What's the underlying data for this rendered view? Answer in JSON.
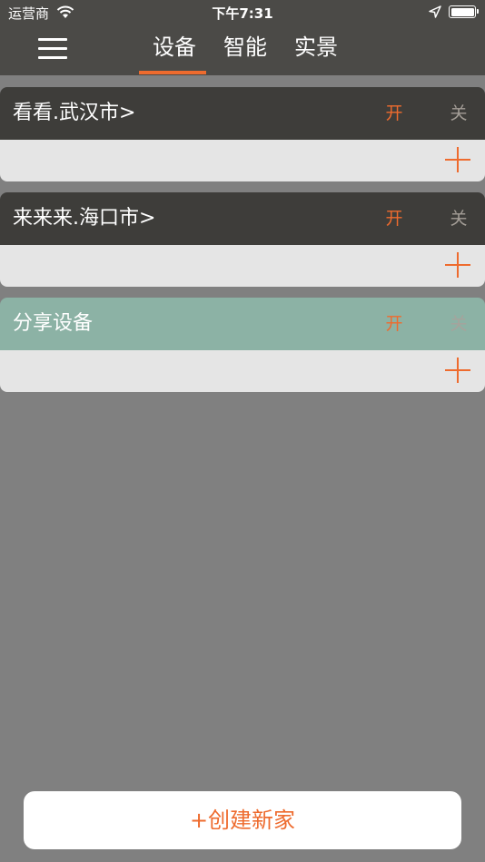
{
  "status_bar": {
    "carrier": "运营商",
    "time": "下午7:31",
    "icons": [
      "wifi-icon",
      "location-arrow-icon",
      "battery-icon"
    ]
  },
  "nav": {
    "menu_icon": "hamburger-menu-icon",
    "tabs": [
      {
        "label": "设备",
        "active": true
      },
      {
        "label": "智能",
        "active": false
      },
      {
        "label": "实景",
        "active": false
      }
    ]
  },
  "homes": [
    {
      "title": "看看.武汉市>",
      "on_label": "开",
      "off_label": "关",
      "add_icon": "plus-icon"
    },
    {
      "title": "来来来.海口市>",
      "on_label": "开",
      "off_label": "关",
      "add_icon": "plus-icon"
    },
    {
      "title": "分享设备",
      "on_label": "开",
      "off_label": "关",
      "add_icon": "plus-icon"
    }
  ],
  "create_button": {
    "label": "+创建新家"
  },
  "colors": {
    "accent": "#ee6b2e",
    "nav_background": "#4b4a47",
    "card_header": "#3e3d3a",
    "shared_header": "#8cb2a5",
    "card_body": "#e5e5e5",
    "page_background": "#808080"
  }
}
